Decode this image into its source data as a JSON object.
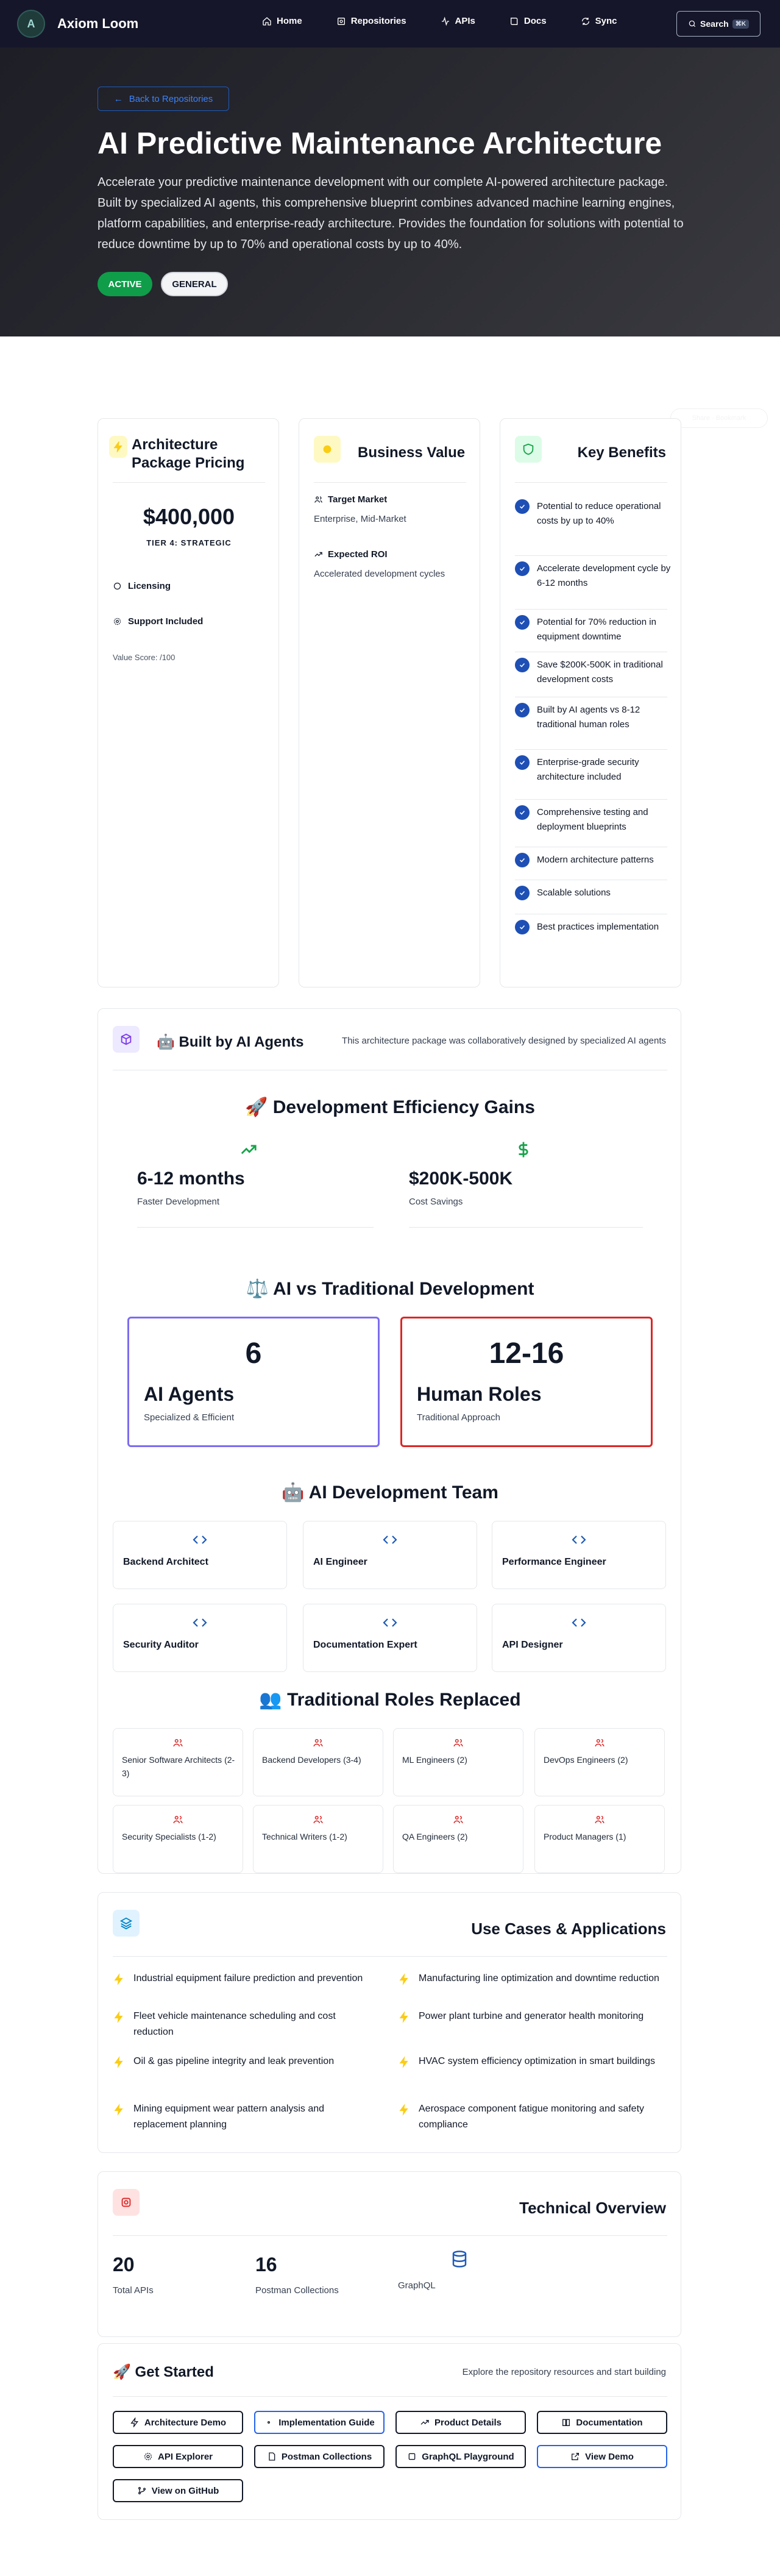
{
  "nav": {
    "logo_letter": "A",
    "brand": "Axiom Loom",
    "items": [
      {
        "label": "Home",
        "icon": "home-icon"
      },
      {
        "label": "Repositories",
        "icon": "package-icon"
      },
      {
        "label": "APIs",
        "icon": "activity-icon"
      },
      {
        "label": "Docs",
        "icon": "book-icon"
      },
      {
        "label": "Sync",
        "icon": "sync-icon"
      }
    ],
    "search_label": "Search",
    "search_shortcut": "⌘K"
  },
  "hero": {
    "back_label": "Back to Repositories",
    "title": "AI Predictive Maintenance Architecture",
    "description": "Accelerate your predictive maintenance development with our complete AI-powered architecture package. Built by specialized AI agents, this comprehensive blueprint combines advanced machine learning engines, platform capabilities, and enterprise-ready architecture. Provides the foundation for solutions with potential to reduce downtime by up to 70% and operational costs by up to 40%.",
    "badge_status": "ACTIVE",
    "badge_category": "GENERAL"
  },
  "ghost_label": "Share · Bookmark",
  "pricing": {
    "title": "Architecture Package Pricing",
    "price": "$400,000",
    "tier": "TIER 4: STRATEGIC",
    "licensing": "Licensing",
    "support": "Support Included",
    "value_score": "Value Score: /100"
  },
  "business_value": {
    "title": "Business Value",
    "target_label": "Target Market",
    "target_value": "Enterprise, Mid-Market",
    "roi_label": "Expected ROI",
    "roi_value": "Accelerated development cycles"
  },
  "key_benefits": {
    "title": "Key Benefits",
    "items": [
      "Potential to reduce operational costs by up to 40%",
      "Accelerate development cycle by 6-12 months",
      "Potential for 70% reduction in equipment downtime",
      "Save $200K-500K in traditional development costs",
      "Built by AI agents vs 8-12 traditional human roles",
      "Enterprise-grade security architecture included",
      "Comprehensive testing and deployment blueprints",
      "Modern architecture patterns",
      "Scalable solutions",
      "Best practices implementation"
    ]
  },
  "built_by": {
    "title": "🤖 Built by AI Agents",
    "description": "This architecture package was collaboratively designed by specialized AI agents",
    "efficiency_title": "🚀 Development Efficiency Gains",
    "efficiency": [
      {
        "value": "6-12 months",
        "label": "Faster Development"
      },
      {
        "value": "$200K-500K",
        "label": "Cost Savings"
      }
    ],
    "vs_title": "⚖️ AI vs Traditional Development",
    "ai": {
      "number": "6",
      "label": "AI Agents",
      "sub": "Specialized & Efficient"
    },
    "human": {
      "number": "12-16",
      "label": "Human Roles",
      "sub": "Traditional Approach"
    },
    "team_title": "🤖 AI Development Team",
    "team": [
      "Backend Architect",
      "AI Engineer",
      "Performance Engineer",
      "Security Auditor",
      "Documentation Expert",
      "API Designer"
    ],
    "roles_title": "👥 Traditional Roles Replaced",
    "roles": [
      "Senior Software Architects (2-3)",
      "Backend Developers (3-4)",
      "ML Engineers (2)",
      "DevOps Engineers (2)",
      "Security Specialists (1-2)",
      "Technical Writers (1-2)",
      "QA Engineers (2)",
      "Product Managers (1)"
    ]
  },
  "use_cases": {
    "title": "Use Cases & Applications",
    "items": [
      "Industrial equipment failure prediction and prevention",
      "Manufacturing line optimization and downtime reduction",
      "Fleet vehicle maintenance scheduling and cost reduction",
      "Power plant turbine and generator health monitoring",
      "Oil & gas pipeline integrity and leak prevention",
      "HVAC system efficiency optimization in smart buildings",
      "Mining equipment wear pattern analysis and replacement planning",
      "Aerospace component fatigue monitoring and safety compliance"
    ]
  },
  "technical": {
    "title": "Technical Overview",
    "apis_value": "20",
    "apis_label": "Total APIs",
    "postman_value": "16",
    "postman_label": "Postman Collections",
    "graphql_label": "GraphQL"
  },
  "get_started": {
    "title": "🚀 Get Started",
    "description": "Explore the repository resources and start building",
    "buttons": [
      "Architecture Demo",
      "Implementation Guide",
      "Product Details",
      "Documentation",
      "API Explorer",
      "Postman Collections",
      "GraphQL Playground",
      "View Demo",
      "View on GitHub"
    ]
  },
  "colors": {
    "nav_bg": "#16162a",
    "accent_blue": "#1e5bb8",
    "active_green": "#0f9d4a",
    "ai_border": "#7c6cf0",
    "human_border": "#dc2626"
  }
}
